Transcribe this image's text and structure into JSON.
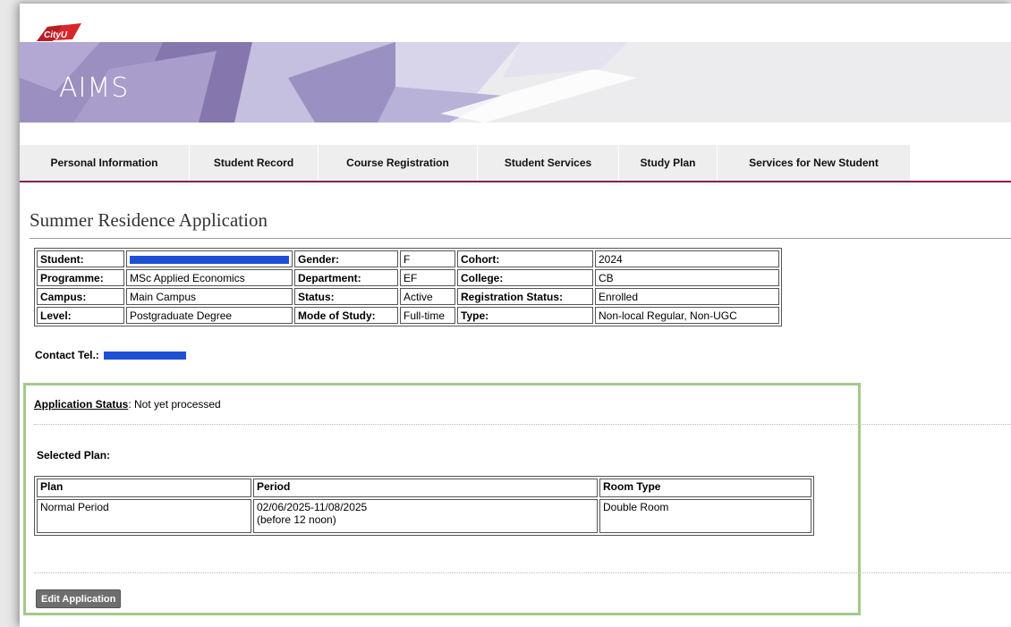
{
  "brand": {
    "logo_text": "CityU",
    "app_title": "AIMS",
    "accent_color": "#8b1d50"
  },
  "nav": {
    "tabs": [
      {
        "label": "Personal Information"
      },
      {
        "label": "Student Record"
      },
      {
        "label": "Course Registration"
      },
      {
        "label": "Student Services"
      },
      {
        "label": "Study Plan"
      },
      {
        "label": "Services for New Student"
      }
    ]
  },
  "page": {
    "title": "Summer Residence Application"
  },
  "student_info": {
    "rows": [
      [
        {
          "label": "Student:",
          "value": ""
        },
        {
          "label": "Gender:",
          "value": "F"
        },
        {
          "label": "Cohort:",
          "value": "2024"
        }
      ],
      [
        {
          "label": "Programme:",
          "value": "MSc Applied Economics"
        },
        {
          "label": "Department:",
          "value": "EF"
        },
        {
          "label": "College:",
          "value": "CB"
        }
      ],
      [
        {
          "label": "Campus:",
          "value": "Main Campus"
        },
        {
          "label": "Status:",
          "value": "Active"
        },
        {
          "label": "Registration Status:",
          "value": "Enrolled"
        }
      ],
      [
        {
          "label": "Level:",
          "value": "Postgraduate Degree"
        },
        {
          "label": "Mode of Study:",
          "value": "Full-time"
        },
        {
          "label": "Type:",
          "value": "Non-local Regular, Non-UGC"
        }
      ]
    ],
    "contact_label": "Contact Tel.:"
  },
  "application": {
    "status_label": "Application Status",
    "status_value": ": Not yet processed",
    "selected_plan_label": "Selected Plan:",
    "plan_table": {
      "headers": [
        "Plan",
        "Period",
        "Room Type"
      ],
      "rows": [
        {
          "plan": "Normal Period",
          "period": "02/06/2025-11/08/2025",
          "period_note": "(before 12 noon)",
          "room_type": "Double Room"
        }
      ]
    },
    "edit_button_label": "Edit Application"
  }
}
